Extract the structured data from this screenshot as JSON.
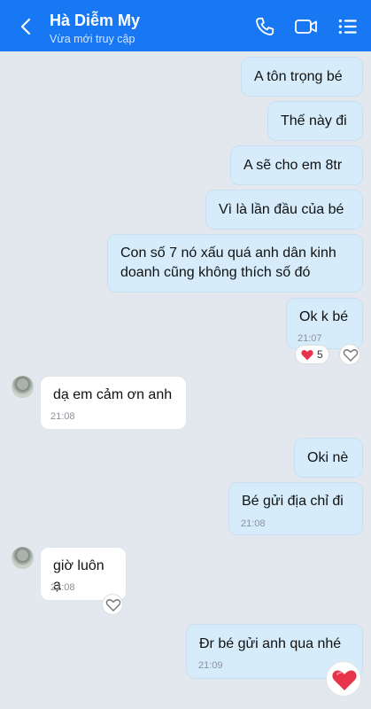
{
  "header": {
    "title": "Hà Diễm My",
    "status": "Vừa mới truy cập",
    "icons": [
      "back-icon",
      "phone-icon",
      "video-icon",
      "menu-icon"
    ]
  },
  "messages": [
    {
      "text": "A tôn trọng bé",
      "direction": "sent"
    },
    {
      "text": "Thế này đi",
      "direction": "sent"
    },
    {
      "text": "A sẽ cho em 8tr",
      "direction": "sent"
    },
    {
      "text": "Vì là lần đầu của bé",
      "direction": "sent"
    },
    {
      "text_line1": "Con số 7 nó xấu quá anh dân kinh",
      "text_line2": "doanh cũng không thích số đó",
      "direction": "sent"
    },
    {
      "text": "Ok k bé",
      "time": "21:07",
      "reaction_count": "5",
      "direction": "sent"
    },
    {
      "text": "dạ em cảm ơn anh",
      "time": "21:08",
      "direction": "received"
    },
    {
      "text": "Oki nè",
      "direction": "sent"
    },
    {
      "text": "Bé gửi địa chỉ đi",
      "time": "21:08",
      "direction": "sent"
    },
    {
      "text": "giờ luôn ạ",
      "time": "21:08",
      "direction": "received"
    },
    {
      "text": "Đr bé gửi anh qua nhé",
      "time": "21:09",
      "direction": "sent"
    }
  ],
  "colors": {
    "header": "#1877f2",
    "sent_bubble": "#d6ecfb",
    "received_bubble": "#ffffff",
    "heart": "#e8344a"
  }
}
